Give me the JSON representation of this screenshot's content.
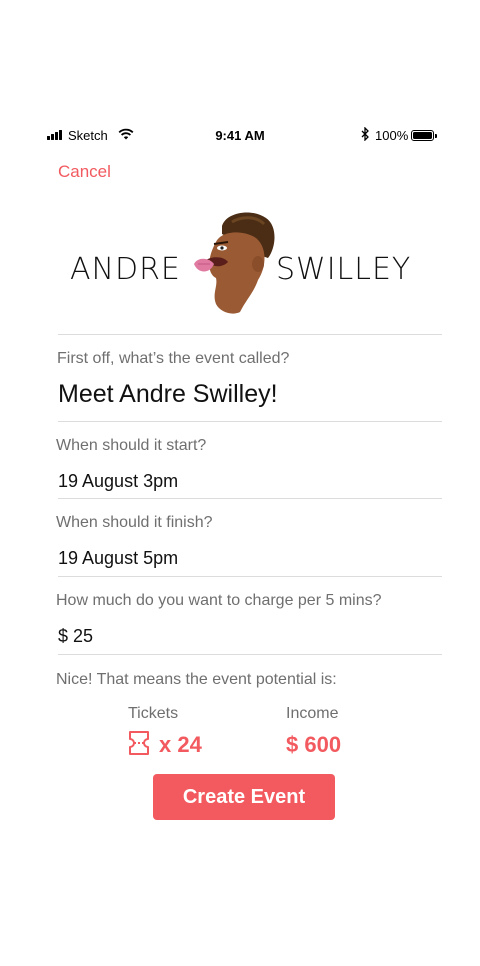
{
  "status_bar": {
    "carrier": "Sketch",
    "time": "9:41 AM",
    "battery": "100%"
  },
  "nav": {
    "cancel_label": "Cancel"
  },
  "logo": {
    "left_text": "ANDRE",
    "right_text": "SWILLEY"
  },
  "form": {
    "name_label": "First off, what’s the event called?",
    "name_value": "Meet Andre Swilley!",
    "start_label": "When should it start?",
    "start_value": "19 August 3pm",
    "finish_label": "When should it finish?",
    "finish_value": "19 August 5pm",
    "charge_label": "How much do you want to charge per 5 mins?",
    "charge_value": "$ 25"
  },
  "summary": {
    "intro": "Nice! That means the event potential is:",
    "tickets_label": "Tickets",
    "tickets_value": "x 24",
    "income_label": "Income",
    "income_value": "$ 600"
  },
  "actions": {
    "create_label": "Create Event"
  },
  "colors": {
    "accent": "#f25a5f",
    "label": "#6f6f6f",
    "divider": "#dcdcdc"
  },
  "icons": [
    "signal-icon",
    "wifi-icon",
    "bluetooth-icon",
    "battery-icon",
    "ticket-icon"
  ]
}
